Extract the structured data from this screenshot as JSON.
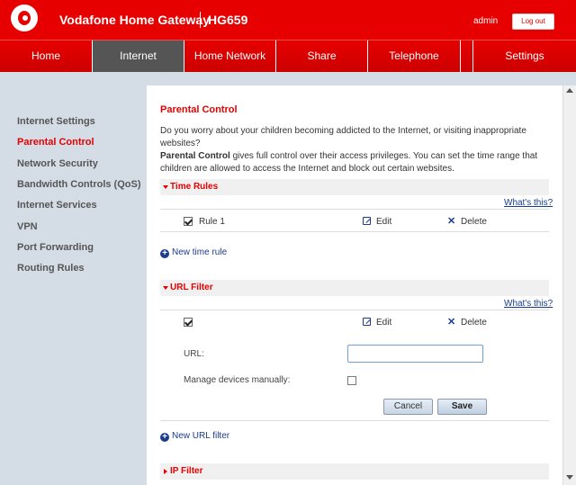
{
  "header": {
    "brand": "Vodafone Home Gateway",
    "model": "HG659",
    "user": "admin",
    "logout_label": "Log out",
    "brand_color": "#e60000"
  },
  "nav": {
    "tabs": [
      {
        "label": "Home",
        "active": false
      },
      {
        "label": "Internet",
        "active": true
      },
      {
        "label": "Home Network",
        "active": false
      },
      {
        "label": "Share",
        "active": false
      },
      {
        "label": "Telephone",
        "active": false
      },
      {
        "label": "Settings",
        "active": false
      }
    ]
  },
  "sidebar": {
    "items": [
      {
        "label": "Internet Settings",
        "active": false
      },
      {
        "label": "Parental Control",
        "active": true
      },
      {
        "label": "Network Security",
        "active": false
      },
      {
        "label": "Bandwidth Controls (QoS)",
        "active": false
      },
      {
        "label": "Internet Services",
        "active": false
      },
      {
        "label": "VPN",
        "active": false
      },
      {
        "label": "Port Forwarding",
        "active": false
      },
      {
        "label": "Routing Rules",
        "active": false
      }
    ]
  },
  "main": {
    "title": "Parental Control",
    "intro_part1": "Do you worry about your children becoming addicted to the Internet, or visiting inappropriate websites?",
    "intro_bold": "Parental Control",
    "intro_part2": " gives full control over their access privileges. You can set the time range that children are allowed to access the Internet and block out certain websites.",
    "time_rules": {
      "title": "Time Rules",
      "whats_this": "What's this?",
      "rule_name": "Rule 1",
      "edit_label": "Edit",
      "delete_label": "Delete",
      "add_label": "New time rule"
    },
    "url_filter": {
      "title": "URL Filter",
      "whats_this": "What's this?",
      "edit_label": "Edit",
      "delete_label": "Delete",
      "url_label": "URL:",
      "url_value": "",
      "manage_label": "Manage devices manually:",
      "cancel_label": "Cancel",
      "save_label": "Save",
      "add_label": "New URL filter"
    },
    "ip_filter": {
      "title": "IP Filter"
    }
  }
}
